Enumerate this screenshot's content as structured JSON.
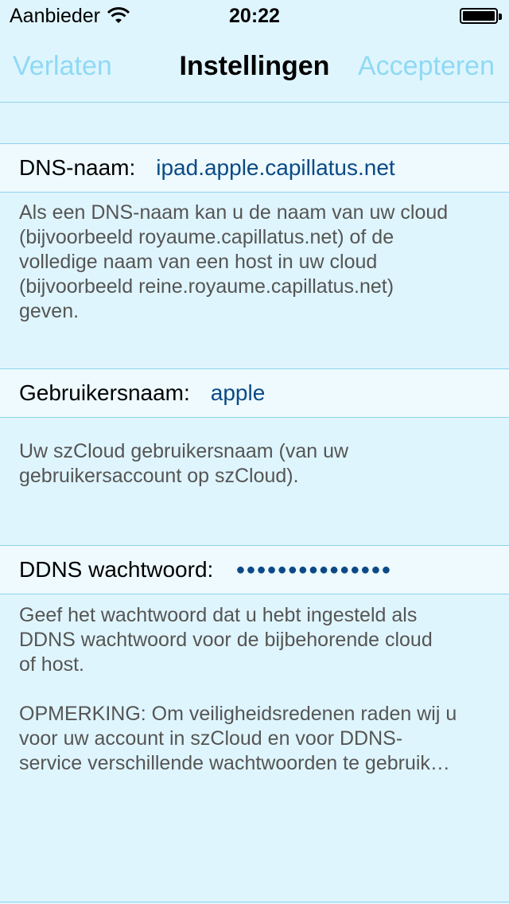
{
  "status": {
    "carrier": "Aanbieder",
    "time": "20:22"
  },
  "nav": {
    "left": "Verlaten",
    "title": "Instellingen",
    "right": "Accepteren"
  },
  "dns": {
    "label": "DNS-naam:",
    "value": "ipad.apple.capillatus.net",
    "help": [
      "Als een DNS-naam kan u de naam van uw cloud",
      "(bijvoorbeeld royaume.capillatus.net) of de",
      "volledige naam van een host in uw cloud",
      "(bijvoorbeeld reine.royaume.capillatus.net)",
      "geven."
    ]
  },
  "user": {
    "label": "Gebruikersnaam:",
    "value": "apple",
    "help": [
      "Uw szCloud gebruikersnaam (van uw",
      "gebruikersaccount op szCloud)."
    ]
  },
  "ddns": {
    "label": "DDNS wachtwoord:",
    "value": "●●●●●●●●●●●●●●●",
    "help": [
      "Geef het wachtwoord dat u hebt ingesteld als",
      "DDNS wachtwoord voor de bijbehorende cloud",
      "of host."
    ],
    "note": [
      "OPMERKING: Om veiligheidsredenen raden wij u",
      "voor uw account in szCloud en voor DDNS-",
      "service verschillende wachtwoorden te gebruik…"
    ]
  }
}
